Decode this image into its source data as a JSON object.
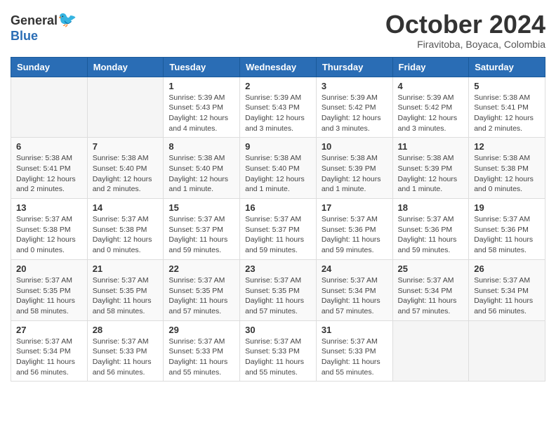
{
  "header": {
    "logo_general": "General",
    "logo_blue": "Blue",
    "month": "October 2024",
    "location": "Firavitoba, Boyaca, Colombia"
  },
  "days_of_week": [
    "Sunday",
    "Monday",
    "Tuesday",
    "Wednesday",
    "Thursday",
    "Friday",
    "Saturday"
  ],
  "weeks": [
    {
      "days": [
        {
          "number": "",
          "info": ""
        },
        {
          "number": "",
          "info": ""
        },
        {
          "number": "1",
          "info": "Sunrise: 5:39 AM\nSunset: 5:43 PM\nDaylight: 12 hours and 4 minutes."
        },
        {
          "number": "2",
          "info": "Sunrise: 5:39 AM\nSunset: 5:43 PM\nDaylight: 12 hours and 3 minutes."
        },
        {
          "number": "3",
          "info": "Sunrise: 5:39 AM\nSunset: 5:42 PM\nDaylight: 12 hours and 3 minutes."
        },
        {
          "number": "4",
          "info": "Sunrise: 5:39 AM\nSunset: 5:42 PM\nDaylight: 12 hours and 3 minutes."
        },
        {
          "number": "5",
          "info": "Sunrise: 5:38 AM\nSunset: 5:41 PM\nDaylight: 12 hours and 2 minutes."
        }
      ]
    },
    {
      "days": [
        {
          "number": "6",
          "info": "Sunrise: 5:38 AM\nSunset: 5:41 PM\nDaylight: 12 hours and 2 minutes."
        },
        {
          "number": "7",
          "info": "Sunrise: 5:38 AM\nSunset: 5:40 PM\nDaylight: 12 hours and 2 minutes."
        },
        {
          "number": "8",
          "info": "Sunrise: 5:38 AM\nSunset: 5:40 PM\nDaylight: 12 hours and 1 minute."
        },
        {
          "number": "9",
          "info": "Sunrise: 5:38 AM\nSunset: 5:40 PM\nDaylight: 12 hours and 1 minute."
        },
        {
          "number": "10",
          "info": "Sunrise: 5:38 AM\nSunset: 5:39 PM\nDaylight: 12 hours and 1 minute."
        },
        {
          "number": "11",
          "info": "Sunrise: 5:38 AM\nSunset: 5:39 PM\nDaylight: 12 hours and 1 minute."
        },
        {
          "number": "12",
          "info": "Sunrise: 5:38 AM\nSunset: 5:38 PM\nDaylight: 12 hours and 0 minutes."
        }
      ]
    },
    {
      "days": [
        {
          "number": "13",
          "info": "Sunrise: 5:37 AM\nSunset: 5:38 PM\nDaylight: 12 hours and 0 minutes."
        },
        {
          "number": "14",
          "info": "Sunrise: 5:37 AM\nSunset: 5:38 PM\nDaylight: 12 hours and 0 minutes."
        },
        {
          "number": "15",
          "info": "Sunrise: 5:37 AM\nSunset: 5:37 PM\nDaylight: 11 hours and 59 minutes."
        },
        {
          "number": "16",
          "info": "Sunrise: 5:37 AM\nSunset: 5:37 PM\nDaylight: 11 hours and 59 minutes."
        },
        {
          "number": "17",
          "info": "Sunrise: 5:37 AM\nSunset: 5:36 PM\nDaylight: 11 hours and 59 minutes."
        },
        {
          "number": "18",
          "info": "Sunrise: 5:37 AM\nSunset: 5:36 PM\nDaylight: 11 hours and 59 minutes."
        },
        {
          "number": "19",
          "info": "Sunrise: 5:37 AM\nSunset: 5:36 PM\nDaylight: 11 hours and 58 minutes."
        }
      ]
    },
    {
      "days": [
        {
          "number": "20",
          "info": "Sunrise: 5:37 AM\nSunset: 5:35 PM\nDaylight: 11 hours and 58 minutes."
        },
        {
          "number": "21",
          "info": "Sunrise: 5:37 AM\nSunset: 5:35 PM\nDaylight: 11 hours and 58 minutes."
        },
        {
          "number": "22",
          "info": "Sunrise: 5:37 AM\nSunset: 5:35 PM\nDaylight: 11 hours and 57 minutes."
        },
        {
          "number": "23",
          "info": "Sunrise: 5:37 AM\nSunset: 5:35 PM\nDaylight: 11 hours and 57 minutes."
        },
        {
          "number": "24",
          "info": "Sunrise: 5:37 AM\nSunset: 5:34 PM\nDaylight: 11 hours and 57 minutes."
        },
        {
          "number": "25",
          "info": "Sunrise: 5:37 AM\nSunset: 5:34 PM\nDaylight: 11 hours and 57 minutes."
        },
        {
          "number": "26",
          "info": "Sunrise: 5:37 AM\nSunset: 5:34 PM\nDaylight: 11 hours and 56 minutes."
        }
      ]
    },
    {
      "days": [
        {
          "number": "27",
          "info": "Sunrise: 5:37 AM\nSunset: 5:34 PM\nDaylight: 11 hours and 56 minutes."
        },
        {
          "number": "28",
          "info": "Sunrise: 5:37 AM\nSunset: 5:33 PM\nDaylight: 11 hours and 56 minutes."
        },
        {
          "number": "29",
          "info": "Sunrise: 5:37 AM\nSunset: 5:33 PM\nDaylight: 11 hours and 55 minutes."
        },
        {
          "number": "30",
          "info": "Sunrise: 5:37 AM\nSunset: 5:33 PM\nDaylight: 11 hours and 55 minutes."
        },
        {
          "number": "31",
          "info": "Sunrise: 5:37 AM\nSunset: 5:33 PM\nDaylight: 11 hours and 55 minutes."
        },
        {
          "number": "",
          "info": ""
        },
        {
          "number": "",
          "info": ""
        }
      ]
    }
  ]
}
